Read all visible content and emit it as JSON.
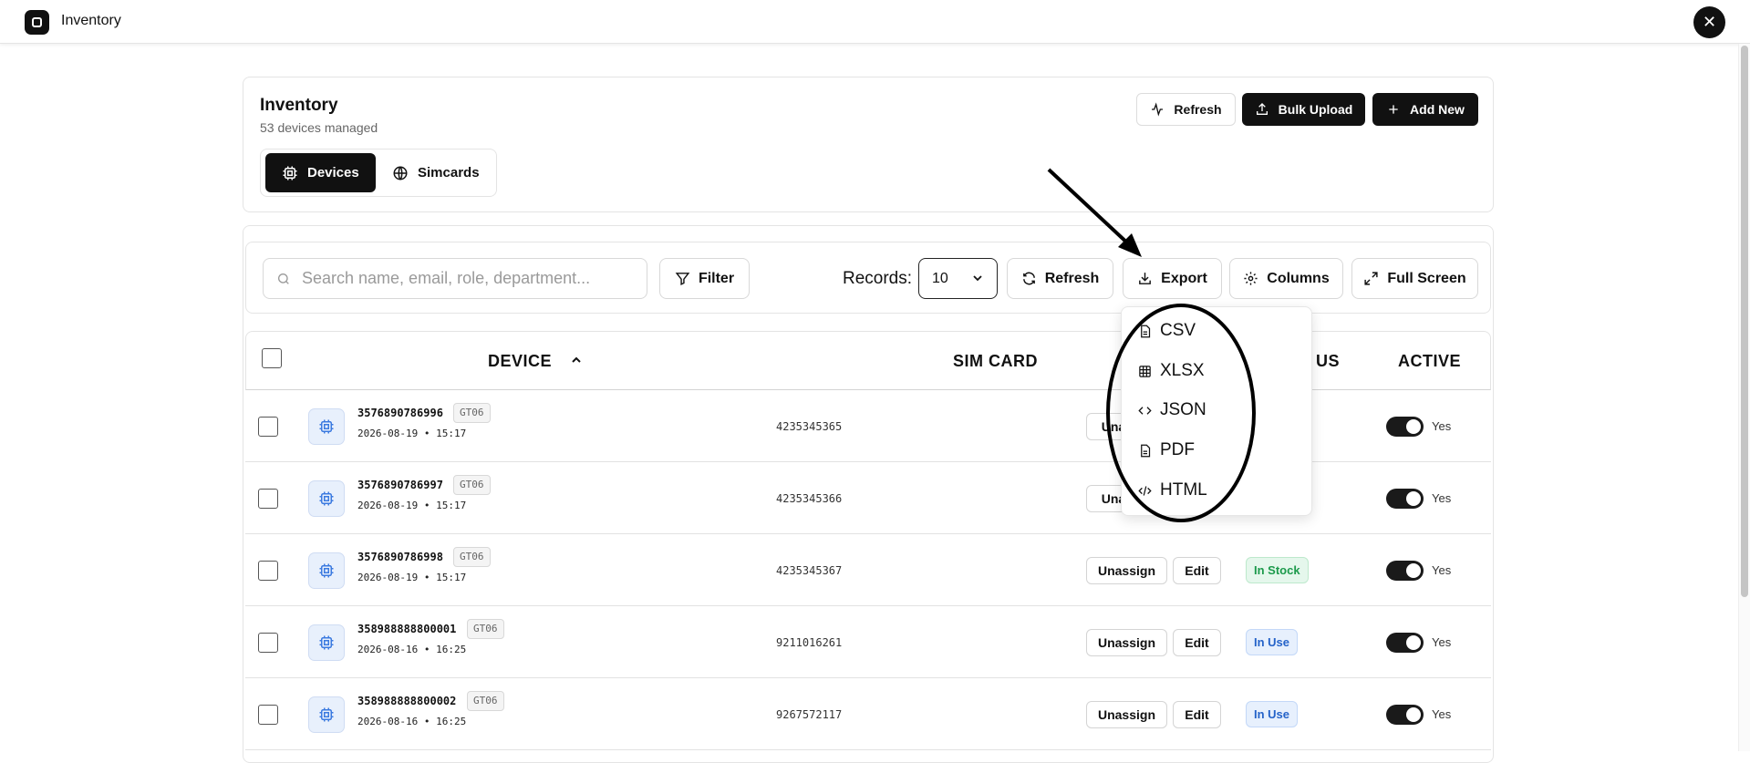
{
  "window": {
    "title": "Inventory",
    "close_label": "✕"
  },
  "header": {
    "title": "Inventory",
    "subtitle": "53 devices managed",
    "tabs": [
      {
        "label": "Devices",
        "icon": "cpu-icon",
        "active": true
      },
      {
        "label": "Simcards",
        "icon": "globe-icon",
        "active": false
      }
    ],
    "actions": {
      "refresh": "Refresh",
      "bulk_upload": "Bulk Upload",
      "add_new": "Add New"
    }
  },
  "toolbar": {
    "search_placeholder": "Search name, email, role, department...",
    "filter": "Filter",
    "records_label": "Records:",
    "records_value": "10",
    "refresh": "Refresh",
    "export": "Export",
    "columns": "Columns",
    "full_screen": "Full Screen"
  },
  "export_menu": [
    {
      "label": "CSV",
      "icon": "file-text-icon"
    },
    {
      "label": "XLSX",
      "icon": "table-icon"
    },
    {
      "label": "JSON",
      "icon": "code-icon"
    },
    {
      "label": "PDF",
      "icon": "file-text-icon"
    },
    {
      "label": "HTML",
      "icon": "code-slash-icon"
    }
  ],
  "table": {
    "columns": {
      "device": "DEVICE",
      "device_sort": "^",
      "sim_card": "SIM CARD",
      "status": "US",
      "active": "ACTIVE"
    },
    "rows": [
      {
        "device_id": "3576890786996",
        "model": "GT06",
        "date": "2026-08-19  •  15:17",
        "sim": "4235345365",
        "unassign": "Una",
        "edit": "",
        "status": "",
        "active_label": "Yes"
      },
      {
        "device_id": "3576890786997",
        "model": "GT06",
        "date": "2026-08-19  •  15:17",
        "sim": "4235345366",
        "unassign": "Una",
        "edit": "",
        "status": "",
        "active_label": "Yes"
      },
      {
        "device_id": "3576890786998",
        "model": "GT06",
        "date": "2026-08-19  •  15:17",
        "sim": "4235345367",
        "unassign": "Unassign",
        "edit": "Edit",
        "status": "In Stock",
        "active_label": "Yes"
      },
      {
        "device_id": "358988888800001",
        "model": "GT06",
        "date": "2026-08-16  •  16:25",
        "sim": "9211016261",
        "unassign": "Unassign",
        "edit": "Edit",
        "status": "In Use",
        "active_label": "Yes"
      },
      {
        "device_id": "358988888800002",
        "model": "GT06",
        "date": "2026-08-16  •  16:25",
        "sim": "9267572117",
        "unassign": "Unassign",
        "edit": "Edit",
        "status": "In Use",
        "active_label": "Yes"
      }
    ]
  }
}
